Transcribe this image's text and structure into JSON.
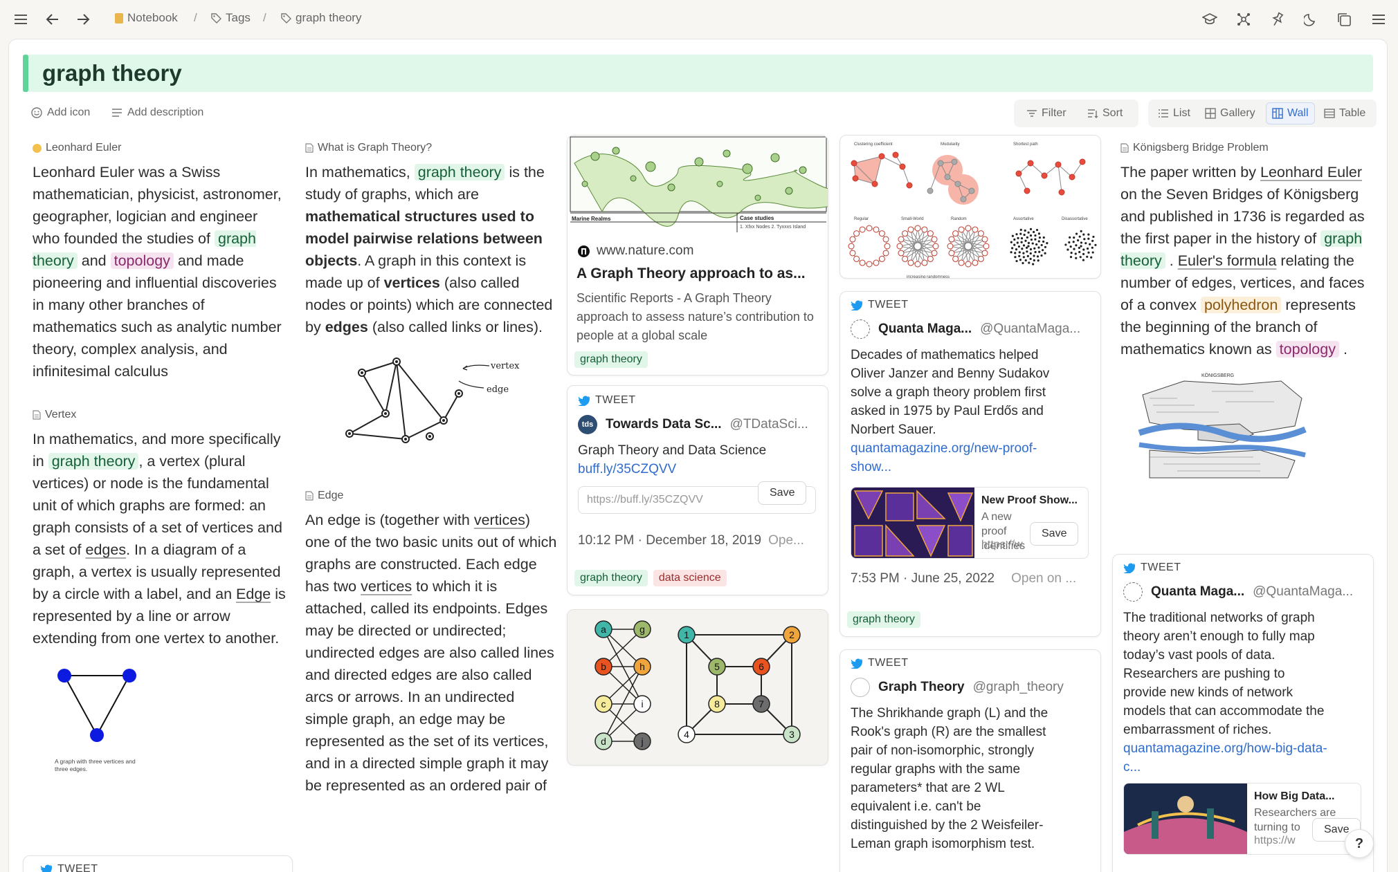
{
  "breadcrumb": {
    "notebook": "Notebook",
    "tags": "Tags",
    "current": "graph theory",
    "sep": "/"
  },
  "page": {
    "title": "graph theory",
    "add_icon": "Add icon",
    "add_description": "Add description"
  },
  "toolbar": {
    "filter": "Filter",
    "sort": "Sort",
    "list": "List",
    "gallery": "Gallery",
    "wall": "Wall",
    "table": "Table",
    "active_view": "Wall"
  },
  "colors": {
    "accent": "#5fd39a",
    "title_bg": "#dff8ea",
    "link": "#2f6cd0",
    "twitter": "#1d9bf0"
  },
  "icons": [
    "menu-icon",
    "back-icon",
    "forward-icon",
    "notebook-icon",
    "tag-icon",
    "graduation-icon",
    "network-icon",
    "pin-icon",
    "moon-icon",
    "copy-icon",
    "more-icon",
    "twitter-icon",
    "smile-icon",
    "lines-icon",
    "filter-icon",
    "sort-icon",
    "list-icon",
    "gallery-icon",
    "wall-icon",
    "table-icon",
    "doc-icon",
    "help-icon"
  ],
  "col1": {
    "euler": {
      "heading": "Leonhard Euler",
      "p1": "Leonhard Euler was a Swiss mathematician, physicist, astronomer, geographer, logician and engineer who founded the studies of",
      "c1": "graph theory",
      "p2": "and",
      "c2": "topology",
      "p3": "and made pioneering and influential discoveries in many other branches of mathematics such as analytic number theory, complex analysis, and infinitesimal calculus"
    },
    "vertex": {
      "heading": "Vertex",
      "p1": "In mathematics, and more specifically in",
      "c1": "graph theory",
      "p2": ", a vertex (plural vertices) or node is the fundamental unit of which graphs are formed: an graph consists of a set of vertices and a set of",
      "l1": "edges",
      "p3": ". In a diagram of a graph, a vertex is usually represented by a circle with a label, and an",
      "l2": "Edge",
      "p4": "is represented by a line or arrow extending from one vertex to another.",
      "caption": "A graph with three vertices and three edges."
    },
    "tweet_stub": "TWEET"
  },
  "col2": {
    "whatis": {
      "heading": "What is Graph Theory?",
      "p1": "In mathematics,",
      "c1": "graph theory",
      "p2": "is the study of graphs, which are",
      "b1": "mathematical structures used to model pairwise relations between objects",
      "p3": ". A graph in this context is made up of",
      "b2": "vertices",
      "p4": "(also called nodes or points) which are connected by",
      "b3": "edges",
      "p5": "(also called links or lines).",
      "diagram_vertex": "vertex",
      "diagram_edge": "edge"
    },
    "edge": {
      "heading": "Edge",
      "p1": "An edge is (together with",
      "l1": "vertices",
      "p2": ") one of the two basic units out of which graphs are constructed. Each edge has two",
      "l2": "vertices",
      "p3": "to which it is attached, called its endpoints. Edges may be directed or undirected; undirected edges are also called lines and directed edges are also called arcs or arrows. In an undirected simple graph, an edge may be represented as the set of its vertices, and in a directed simple graph it may be represented as an ordered pair of"
    }
  },
  "col3": {
    "nature": {
      "map_label1": "Marine Realms",
      "map_label2": "Case studies",
      "map_label3": "1. Xfxx Nodes  2. Tyxxxs Island",
      "domain": "www.nature.com",
      "title": "A Graph Theory approach to as...",
      "desc": "Scientific Reports - A Graph Theory approach to assess nature’s contribution to people at a global scale",
      "tag": "graph theory"
    },
    "tweet1": {
      "label": "TWEET",
      "avatar": "tds",
      "name": "Towards Data Sc...",
      "handle": "@TDataSci...",
      "text": "Graph Theory and Data Science",
      "link": "buff.ly/35CZQVV",
      "input_placeholder": "https://buff.ly/35CZQVV",
      "save": "Save",
      "time": "10:12 PM · December 18, 2019",
      "open": "Ope...",
      "tags": [
        "graph theory",
        "data science"
      ]
    },
    "bipartite": {
      "left": [
        "a",
        "b",
        "c",
        "d"
      ],
      "right": [
        "g",
        "h",
        "i",
        "j"
      ],
      "cube": [
        "1",
        "2",
        "3",
        "4",
        "5",
        "6",
        "7",
        "8"
      ]
    }
  },
  "col4": {
    "network_labels": [
      "Clustering coefficient",
      "Modularity",
      "Shortest path",
      "Regular",
      "Small-World",
      "Random",
      "Assortative",
      "Disassortative",
      "increasing randomness"
    ],
    "tweet2": {
      "label": "TWEET",
      "name": "Quanta Maga...",
      "handle": "@QuantaMaga...",
      "text": "Decades of mathematics helped Oliver Janzer and Benny Sudakov solve a graph theory problem first asked in 1975 by Paul Erdős and Norbert Sauer.",
      "link": "quantamagazine.org/new-proof-show...",
      "preview_title": "New Proof Show...",
      "preview_desc": "A new proof identifies",
      "preview_url": "https://w",
      "save": "Save",
      "time": "7:53 PM · June 25, 2022",
      "open": "Open on ...",
      "tag": "graph theory"
    },
    "tweet3": {
      "label": "TWEET",
      "name": "Graph Theory",
      "handle": "@graph_theory",
      "text": "The Shrikhande graph (L) and the Rook's graph (R) are the smallest pair of non-isomorphic, strongly regular graphs with the same parameters* that are 2 WL equivalent i.e. can't be distinguished by the 2 Weisfeiler-Leman graph isomorphism test."
    }
  },
  "col5": {
    "konig": {
      "heading": "Königsberg Bridge Problem",
      "p1": "The paper written by",
      "l1": "Leonhard Euler",
      "p2": "on the Seven Bridges of Königsberg and published in 1736 is regarded as the first paper in the history of",
      "c1": "graph theory",
      "p3": ".",
      "l2": "Euler's formula",
      "p4": "relating the number of edges, vertices, and faces of a convex",
      "c2": "polyhedron",
      "p5": "represents the beginning of the branch of mathematics known as",
      "c3": "topology",
      "p6": ".",
      "map_title": "KÖNIGSBERG"
    },
    "tweet4": {
      "label": "TWEET",
      "name": "Quanta Maga...",
      "handle": "@QuantaMaga...",
      "text": "The traditional networks of graph theory aren’t enough to fully map today’s vast pools of data. Researchers are pushing to provide new kinds of network models that can accommodate the embarrassment of riches.",
      "link": "quantamagazine.org/how-big-data-c...",
      "preview_title": "How Big Data...",
      "preview_desc": "Researchers are turning to",
      "preview_url": "https://w",
      "save": "Save",
      "help": "?"
    }
  }
}
